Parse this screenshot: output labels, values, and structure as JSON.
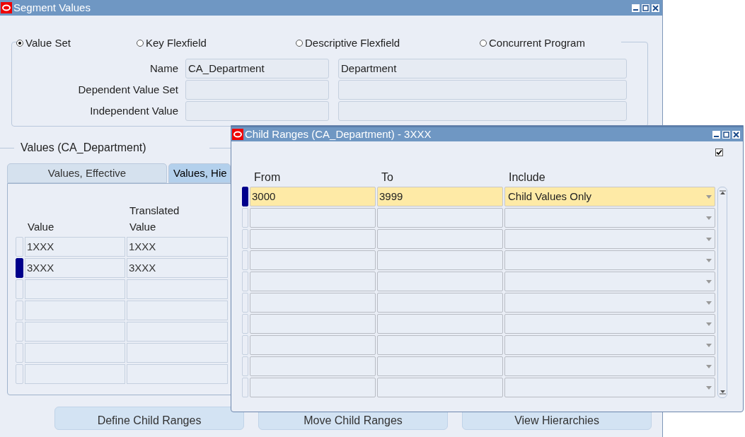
{
  "window": {
    "title": "Segment Values"
  },
  "radio_options": [
    {
      "label": "Value Set",
      "selected": true
    },
    {
      "label": "Key Flexfield",
      "selected": false
    },
    {
      "label": "Descriptive Flexfield",
      "selected": false
    },
    {
      "label": "Concurrent Program",
      "selected": false
    }
  ],
  "fields": [
    {
      "label": "Name",
      "value_1": "CA_Department",
      "value_2": "Department"
    },
    {
      "label": "Dependent Value Set"
    },
    {
      "label": "Independent Value"
    }
  ],
  "values_section": {
    "title": "Values (CA_Department)",
    "tabs": [
      {
        "label": "Values, Effective",
        "selected": false
      },
      {
        "label": "Values, Hie",
        "selected": true
      }
    ],
    "columns": [
      "Value",
      "Translated Value"
    ],
    "rows": [
      {
        "value": "1XXX",
        "translated_value": "1XXX",
        "selected": false
      },
      {
        "value": "3XXX",
        "translated_value": "3XXX",
        "selected": true
      }
    ]
  },
  "buttons": [
    "Define Child Ranges",
    "Move Child Ranges",
    "View Hierarchies"
  ],
  "child_window": {
    "title": "Child Ranges (CA_Department) - 3XXX",
    "checkbox": {
      "checked": true
    },
    "columns": [
      "From",
      "To",
      "Include"
    ],
    "rows": [
      {
        "from": "3000",
        "to": "3999",
        "include": "Child Values Only",
        "selected": true
      }
    ]
  }
}
